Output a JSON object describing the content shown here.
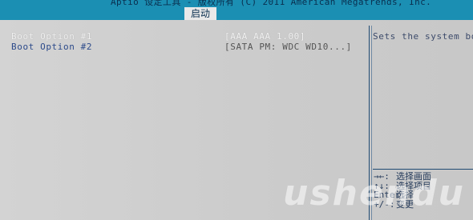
{
  "window": {
    "title": "Aptio 设定工具 - 版权所有 (C) 2011 American Megatrends, Inc."
  },
  "tabs": [
    {
      "label": "启动",
      "active": true
    }
  ],
  "boot_options": [
    {
      "label": "Boot Option #1",
      "value": "[AAA AAA 1.00]",
      "selected": true
    },
    {
      "label": "Boot Option #2",
      "value": "[SATA  PM: WDC WD10...]",
      "selected": false
    }
  ],
  "help": {
    "text": "Sets the system boot"
  },
  "key_help": [
    {
      "key": "→←:",
      "desc": "选择画面"
    },
    {
      "key": "↑↓:",
      "desc": "选择项目"
    },
    {
      "key": "Enter:",
      "desc": "选择"
    },
    {
      "key": "+/-:",
      "desc": "变更"
    }
  ],
  "watermark": {
    "text": "ushendu"
  },
  "colors": {
    "title_bar": "#1b8fb3",
    "panel_bg": "#cfcfcf",
    "divider": "#1f4a72",
    "label_text": "#2c4a8a",
    "selected_text": "#f0f0f0"
  }
}
